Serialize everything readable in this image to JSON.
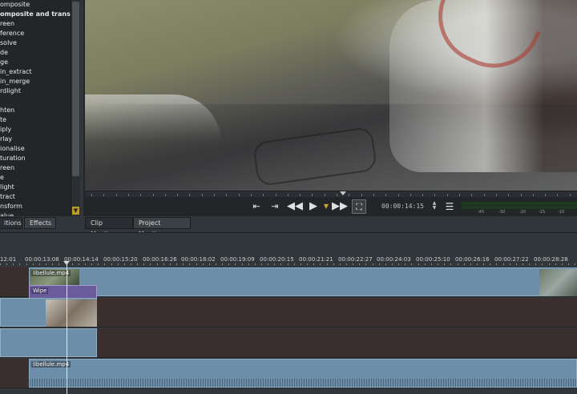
{
  "effects": {
    "items": [
      "omposite",
      "omposite and transfor",
      "reen",
      "ference",
      "solve",
      "de",
      "ge",
      "in_extract",
      "in_merge",
      "rdlight",
      "",
      "hten",
      "te",
      "iply",
      "rlay",
      "ionalise",
      "turation",
      "reen",
      "e",
      "light",
      "tract",
      "nsform",
      "alue"
    ]
  },
  "tabs": {
    "left": [
      "itions",
      "Effects"
    ],
    "right": [
      "Clip Monitor",
      "Project Monitor"
    ]
  },
  "monitor": {
    "timecode": "00:00:14:15",
    "icons": {
      "zone_in": "set-zone-in-icon",
      "zone_out": "set-zone-out-icon",
      "rewind": "rewind-icon",
      "play": "play-icon",
      "play_menu": "chevron-down-icon",
      "forward": "fast-forward-icon",
      "zone": "zone-select-icon",
      "menu": "hamburger-menu-icon"
    },
    "meter_labels": [
      "-45",
      "-30",
      "-20",
      "-15",
      "-10"
    ],
    "accent": "#b89b2a"
  },
  "timeline": {
    "ruler_labels": [
      "12:01",
      "00:00:13:08",
      "00:00:14:14",
      "00:00:15:20",
      "00:00:16:26",
      "00:00:18:02",
      "00:00:19:09",
      "00:00:20:15",
      "00:00:21:21",
      "00:00:22:27",
      "00:00:24:03",
      "00:00:25:10",
      "00:00:26:16",
      "00:00:27:22",
      "00:00:28:28"
    ],
    "clips": {
      "video_top_label": "libellule.mp4",
      "transition_label": "Wipe",
      "audio_label": "libellule.mp4"
    },
    "colors": {
      "clip": "#6d8ea8",
      "transition": "#6a5b9a",
      "track_empty": "#3a2e2e"
    }
  }
}
